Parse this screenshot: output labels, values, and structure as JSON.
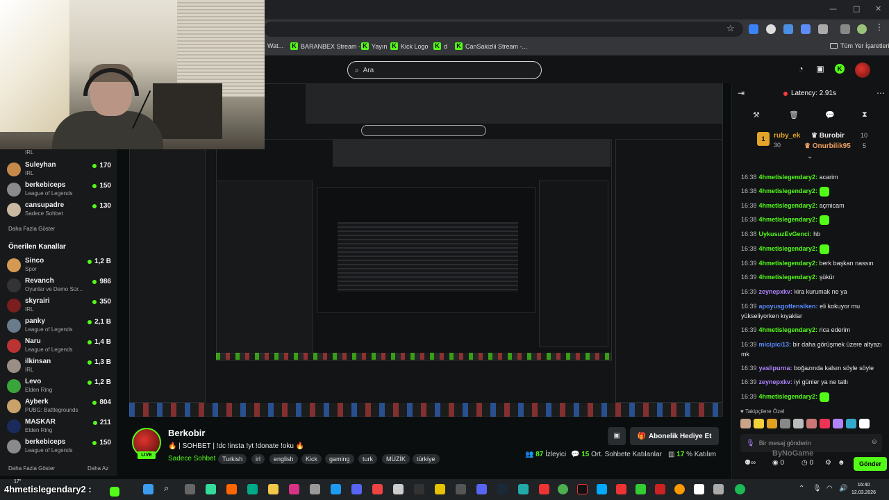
{
  "browser": {
    "bookmarks": [
      {
        "label": "Wat...",
        "kick": false
      },
      {
        "label": "BARANBEX Stream -...",
        "kick": true
      },
      {
        "label": "Yayın",
        "kick": true
      },
      {
        "label": "Kick Logo",
        "kick": true
      },
      {
        "label": "d",
        "kick": true
      },
      {
        "label": "CanSakizlii Stream -...",
        "kick": true
      }
    ],
    "all_bookmarks": "Tüm Yer İşaretleri",
    "window_min": "—",
    "window_max": "□",
    "window_close": "✕"
  },
  "header": {
    "search_placeholder": "Ara"
  },
  "sidebar": {
    "top_channels": [
      {
        "name": "",
        "category": "IRL",
        "viewers": "",
        "color": "#555"
      },
      {
        "name": "Suleyhan",
        "category": "IRL",
        "viewers": "170",
        "color": "#c58a4a"
      },
      {
        "name": "berkebiceps",
        "category": "League of Legends",
        "viewers": "150",
        "color": "#8a8a8a"
      },
      {
        "name": "cansupadre",
        "category": "Sadece Sohbet",
        "viewers": "130",
        "color": "#c9b9a3"
      }
    ],
    "more_label": "Daha Fazla Göster",
    "recommended_heading": "Önerilen Kanallar",
    "recommended": [
      {
        "name": "Sinco",
        "category": "Spor",
        "viewers": "1,2 B",
        "color": "#d59a52"
      },
      {
        "name": "Revanch",
        "category": "Oyunlar ve Demo Sür...",
        "viewers": "986",
        "color": "#333"
      },
      {
        "name": "skyrairi",
        "category": "IRL",
        "viewers": "350",
        "color": "#7a1e1e"
      },
      {
        "name": "panky",
        "category": "League of Legends",
        "viewers": "2,1 B",
        "color": "#6a7b8c"
      },
      {
        "name": "Naru",
        "category": "League of Legends",
        "viewers": "1,4 B",
        "color": "#b33"
      },
      {
        "name": "ilkinsan",
        "category": "IRL",
        "viewers": "1,3 B",
        "color": "#9a8f84"
      },
      {
        "name": "Levo",
        "category": "Elden Ring",
        "viewers": "1,2 B",
        "color": "#3aa53a"
      },
      {
        "name": "Ayberk",
        "category": "PUBG: Battlegrounds",
        "viewers": "804",
        "color": "#c8a26a"
      },
      {
        "name": "MASKAR",
        "category": "Elden Ring",
        "viewers": "211",
        "color": "#1a2a5a"
      },
      {
        "name": "berkebiceps",
        "category": "League of Legends",
        "viewers": "150",
        "color": "#8a8a8a"
      }
    ],
    "more_label_2": "Daha Fazla Göster",
    "less_label": "Daha Az"
  },
  "stream": {
    "streamer": "Berkobir",
    "live": "LIVE",
    "title": "🔥 | SOHBET | !dc !insta !yt !donate !oku 🔥",
    "category": "Sadece Sohbet",
    "tags": [
      "Turkish",
      "irl",
      "english",
      "Kick",
      "gaming",
      "turk",
      "MÜZİK",
      "türkiye"
    ],
    "viewers_value": "87",
    "viewers_label": "İzleyici",
    "chatters_value": "15",
    "chatters_label": "Ort. Sohbete Katılanlar",
    "participation_value": "17",
    "participation_label": "% Katılım",
    "gift_button": "Abonelik Hediye Et"
  },
  "chat": {
    "latency": "Latency: 2.91s",
    "gifters": {
      "first_name": "ruby_ek",
      "first_value": "30",
      "second_name": "Burobir",
      "second_value": "10",
      "third_name": "Onurbilik95",
      "third_value": "5",
      "rank": "1"
    },
    "messages": [
      {
        "time": "16:38",
        "user": "4hmetislegendary2:",
        "text": "acarim",
        "color": "#53fc18",
        "emote": false
      },
      {
        "time": "16:38",
        "user": "4hmetislegendary2:",
        "text": "",
        "color": "#53fc18",
        "emote": true
      },
      {
        "time": "16:38",
        "user": "4hmetislegendary2:",
        "text": "açmicam",
        "color": "#53fc18",
        "emote": false
      },
      {
        "time": "16:38",
        "user": "4hmetislegendary2:",
        "text": "",
        "color": "#53fc18",
        "emote": true
      },
      {
        "time": "16:38",
        "user": "UykusuzEvGenci:",
        "text": "hb",
        "color": "#53fc18",
        "emote": false
      },
      {
        "time": "16:38",
        "user": "4hmetislegendary2:",
        "text": "",
        "color": "#53fc18",
        "emote": true
      },
      {
        "time": "16:39",
        "user": "4hmetislegendary2:",
        "text": "berk başkan nassın",
        "color": "#53fc18",
        "emote": false
      },
      {
        "time": "16:39",
        "user": "4hmetislegendary2:",
        "text": "şükür",
        "color": "#53fc18",
        "emote": false
      },
      {
        "time": "16:39",
        "user": "zeynepxkv:",
        "text": "kira kurumak ne ya",
        "color": "#b084ff",
        "emote": false
      },
      {
        "time": "16:39",
        "user": "apoyusgottensiken:",
        "text": "eli kokuyor mu yükseliyorken kıyaklar",
        "color": "#5b8cff",
        "emote": false
      },
      {
        "time": "16:39",
        "user": "4hmetislegendary2:",
        "text": "rica ederim",
        "color": "#53fc18",
        "emote": false
      },
      {
        "time": "16:39",
        "user": "micipici13:",
        "text": "bir daha görüşmek üzere altyazı mk",
        "color": "#5b8cff",
        "emote": false
      },
      {
        "time": "16:39",
        "user": "yaslipurna:",
        "text": "boğazında kalsın söyle söyle",
        "color": "#b084ff",
        "emote": false
      },
      {
        "time": "16:39",
        "user": "zeynepxkv:",
        "text": "iyi günler ya ne tatlı",
        "color": "#b084ff",
        "emote": false
      },
      {
        "time": "16:39",
        "user": "4hmetislegendary2:",
        "text": "",
        "color": "#53fc18",
        "emote": true
      }
    ],
    "followers_label": "Takipçilere Özel",
    "input_placeholder": "Bir mesaj gönderin",
    "send_label": "Gönder",
    "bottom_count": "0",
    "watermark": "ByNoGame"
  },
  "overlay": {
    "username": "4hmetislegendary2 :",
    "temp": "17°"
  },
  "taskbar": {
    "time": "16:40",
    "date": "12.03.2026"
  }
}
